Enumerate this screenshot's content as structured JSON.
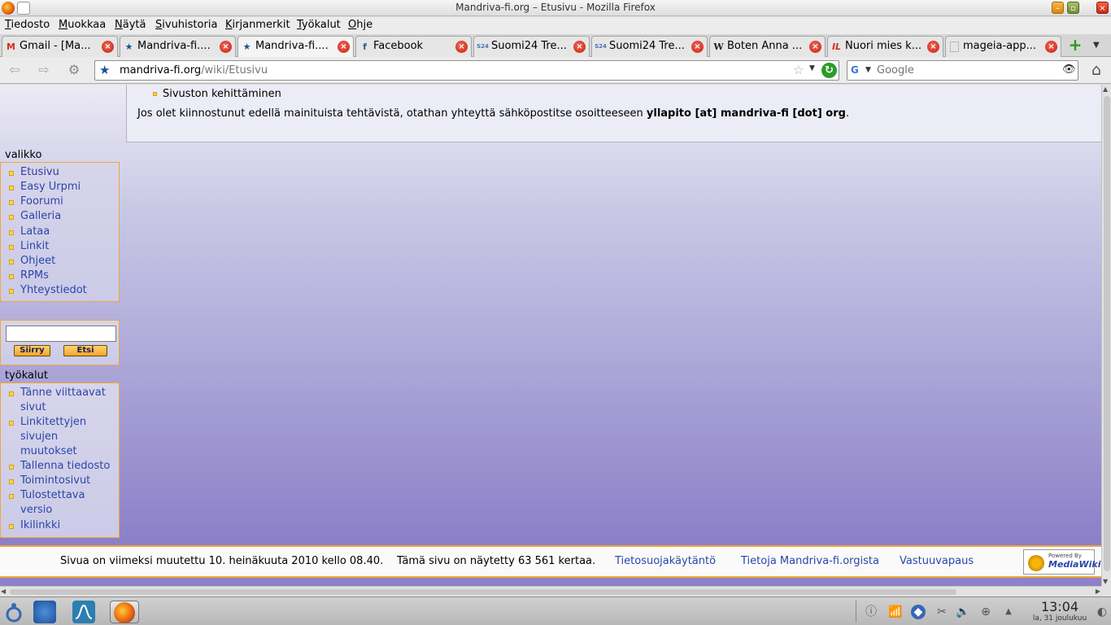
{
  "window": {
    "title": "Mandriva-fi.org – Etusivu - Mozilla Firefox"
  },
  "menu": [
    "Tiedosto",
    "Muokkaa",
    "Näytä",
    "Sivuhistoria",
    "Kirjanmerkit",
    "Työkalut",
    "Ohje"
  ],
  "tabs": [
    {
      "label": "Gmail - [Ma...",
      "icon": "gmail-icon",
      "glyph": "M",
      "color": "#d42e1e"
    },
    {
      "label": "Mandriva-fi....",
      "icon": "mandriva-star-icon",
      "glyph": "★",
      "color": "#1d4f9c"
    },
    {
      "label": "Mandriva-fi....",
      "icon": "mandriva-star-icon",
      "glyph": "★",
      "color": "#1d4f9c"
    },
    {
      "label": "Facebook",
      "icon": "facebook-icon",
      "glyph": "f",
      "color": "#3b5998"
    },
    {
      "label": "Suomi24 Tre...",
      "icon": "suomi24-icon",
      "glyph": "S24",
      "color": "#4a6fb5"
    },
    {
      "label": "Suomi24 Tre...",
      "icon": "suomi24-icon",
      "glyph": "S24",
      "color": "#4a6fb5"
    },
    {
      "label": "Boten Anna ...",
      "icon": "wikipedia-icon",
      "glyph": "W",
      "color": "#222222"
    },
    {
      "label": "Nuori mies k...",
      "icon": "iltalehti-icon",
      "glyph": "IL",
      "color": "#d42e1e"
    },
    {
      "label": "mageia-app...",
      "icon": "blank-page-icon",
      "glyph": "",
      "color": "#888888"
    }
  ],
  "nav": {
    "url_host": "mandriva-fi.org",
    "url_path": "/wiki/Etusivu",
    "search_placeholder": "Google"
  },
  "content": {
    "list_item": "Sivuston kehittäminen",
    "para_text": "Jos olet kiinnostunut edellä mainituista tehtävistä, otathan yhteyttä sähköpostitse osoitteeseen ",
    "para_email": "yllapito [at] mandriva-fi [dot] org",
    "para_end": "."
  },
  "sidebar": {
    "valikko_title": "valikko",
    "valikko_items": [
      "Etusivu",
      "Easy Urpmi",
      "Foorumi",
      "Galleria",
      "Lataa",
      "Linkit",
      "Ohjeet",
      "RPMs",
      "Yhteystiedot"
    ],
    "search_go": "Siirry",
    "search_search": "Etsi",
    "tools_title": "työkalut",
    "tools_items": [
      "Tänne viittaavat sivut",
      "Linkitettyjen sivujen muutokset",
      "Tallenna tiedosto",
      "Toimintosivut",
      "Tulostettava versio",
      "Ikilinkki"
    ]
  },
  "footer": {
    "last_modified": "Sivua on viimeksi muutettu 10. heinäkuuta 2010 kello 08.40.",
    "views": "Tämä sivu on näytetty 63 561 kertaa.",
    "privacy": "Tietosuojakäytäntö",
    "about": "Tietoja Mandriva-fi.orgista",
    "disclaimer": "Vastuuvapaus",
    "badge_small": "Powered By",
    "badge_big": "MediaWiki"
  },
  "taskbar": {
    "time": "13:04",
    "date": "la, 31 joulukuu"
  },
  "colors": {
    "link": "#2a46a8",
    "accent": "#f0a63a",
    "page_gradient_bottom": "#8c80c8"
  }
}
